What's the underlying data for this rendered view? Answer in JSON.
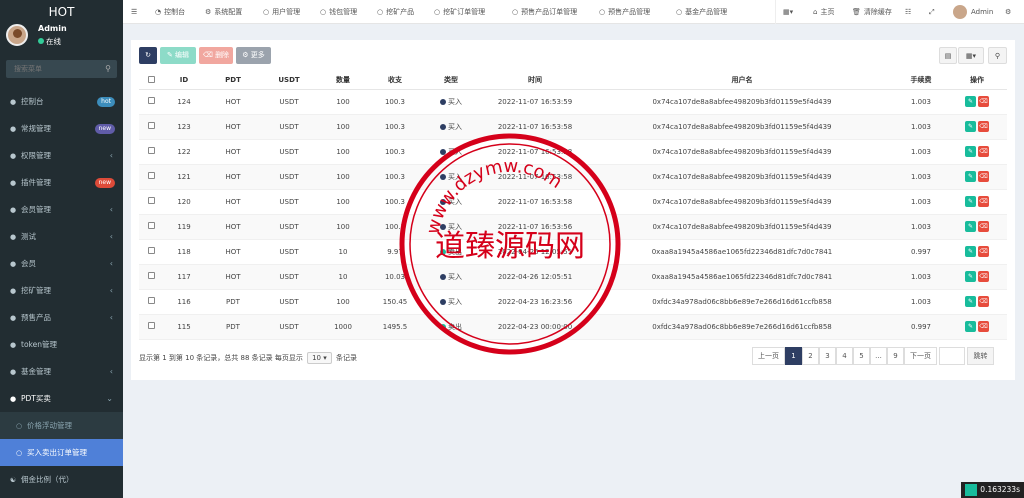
{
  "app": {
    "logo": "HOT"
  },
  "user": {
    "name": "Admin",
    "status": "在线"
  },
  "sidebar": {
    "search_placeholder": "搜索菜单",
    "items": [
      {
        "label": "控制台",
        "icon": "dashboard-icon",
        "badge": "hot",
        "badge_color": "#3c8dbc"
      },
      {
        "label": "常规管理",
        "icon": "gear-icon",
        "badge": "new",
        "badge_color": "#605ca8"
      },
      {
        "label": "权限管理",
        "icon": "users-icon",
        "chevron": "‹"
      },
      {
        "label": "插件管理",
        "icon": "rocket-icon",
        "badge": "new",
        "badge_color": "#dd4b39"
      },
      {
        "label": "会员管理",
        "icon": "user-icon",
        "chevron": "‹"
      },
      {
        "label": "测试",
        "icon": "flask-icon",
        "chevron": "‹"
      },
      {
        "label": "会员",
        "icon": "member-icon",
        "chevron": "‹"
      },
      {
        "label": "挖矿管理",
        "icon": "pickaxe-icon",
        "chevron": "‹"
      },
      {
        "label": "预售产品",
        "icon": "cart-icon",
        "chevron": "‹"
      },
      {
        "label": "token管理",
        "icon": "token-icon"
      },
      {
        "label": "基金管理",
        "icon": "fund-icon",
        "chevron": "‹"
      },
      {
        "label": "PDT买卖",
        "icon": "exchange-icon",
        "chevron": "⌄"
      }
    ],
    "sub_items": [
      {
        "label": "价格浮动管理"
      },
      {
        "label": "买入卖出订单管理"
      }
    ],
    "last_item": {
      "label": "佣金比例（代）",
      "icon": "percent-icon"
    }
  },
  "topbar": {
    "nav": [
      {
        "label": "控制台",
        "icon": "dashboard-icon"
      },
      {
        "label": "系统配置",
        "icon": "gear-icon"
      },
      {
        "label": "用户管理",
        "icon": "circle-icon"
      },
      {
        "label": "钱包管理",
        "icon": "circle-icon"
      },
      {
        "label": "挖矿产品",
        "icon": "circle-icon"
      },
      {
        "label": "挖矿订单管理",
        "icon": "circle-icon"
      },
      {
        "label": "预售产品订单管理",
        "icon": "circle-icon"
      },
      {
        "label": "预售产品管理",
        "icon": "circle-icon"
      },
      {
        "label": "基金产品管理",
        "icon": "circle-icon"
      }
    ],
    "home": "主页",
    "clear_cache": "清除缓存",
    "admin": "Admin"
  },
  "toolbar": {
    "edit": "编辑",
    "delete": "删除",
    "more": "更多"
  },
  "table": {
    "headers": [
      "ID",
      "PDT",
      "USDT",
      "数量",
      "收支",
      "类型",
      "时间",
      "用户名",
      "手续费",
      "操作"
    ],
    "rows": [
      [
        "124",
        "HOT",
        "USDT",
        "100",
        "100.3",
        "买入",
        "2022-11-07 16:53:59",
        "0x74ca107de8a8abfee498209b3fd01159e5f4d439",
        "1.003"
      ],
      [
        "123",
        "HOT",
        "USDT",
        "100",
        "100.3",
        "买入",
        "2022-11-07 16:53:58",
        "0x74ca107de8a8abfee498209b3fd01159e5f4d439",
        "1.003"
      ],
      [
        "122",
        "HOT",
        "USDT",
        "100",
        "100.3",
        "买入",
        "2022-11-07 16:53:58",
        "0x74ca107de8a8abfee498209b3fd01159e5f4d439",
        "1.003"
      ],
      [
        "121",
        "HOT",
        "USDT",
        "100",
        "100.3",
        "买入",
        "2022-11-07 16:53:58",
        "0x74ca107de8a8abfee498209b3fd01159e5f4d439",
        "1.003"
      ],
      [
        "120",
        "HOT",
        "USDT",
        "100",
        "100.3",
        "买入",
        "2022-11-07 16:53:58",
        "0x74ca107de8a8abfee498209b3fd01159e5f4d439",
        "1.003"
      ],
      [
        "119",
        "HOT",
        "USDT",
        "100",
        "100.3",
        "买入",
        "2022-11-07 16:53:56",
        "0x74ca107de8a8abfee498209b3fd01159e5f4d439",
        "1.003"
      ],
      [
        "118",
        "HOT",
        "USDT",
        "10",
        "9.97",
        "卖出",
        "2022-04-26 12:05:51",
        "0xaa8a1945a4586ae1065fd22346d81dfc7d0c7841",
        "0.997"
      ],
      [
        "117",
        "HOT",
        "USDT",
        "10",
        "10.03",
        "买入",
        "2022-04-26 12:05:51",
        "0xaa8a1945a4586ae1065fd22346d81dfc7d0c7841",
        "1.003"
      ],
      [
        "116",
        "PDT",
        "USDT",
        "100",
        "150.45",
        "买入",
        "2022-04-23 16:23:56",
        "0xfdc34a978ad06c8bb6e89e7e266d16d61ccfb858",
        "1.003"
      ],
      [
        "115",
        "PDT",
        "USDT",
        "1000",
        "1495.5",
        "卖出",
        "2022-04-23 00:00:00",
        "0xfdc34a978ad06c8bb6e89e7e266d16d61ccfb858",
        "0.997"
      ]
    ]
  },
  "pagination": {
    "info_prefix": "显示第 1 到第 10 条记录，总共 88 条记录 每页显示",
    "page_size": "10",
    "info_suffix": "条记录",
    "prev": "上一页",
    "pages": [
      "1",
      "2",
      "3",
      "4",
      "5",
      "...",
      "9"
    ],
    "next": "下一页",
    "jump": "跳转"
  },
  "watermark": {
    "center": "道臻源码网",
    "ring_text": "www.dzymw.com"
  },
  "timer": "0.163233s"
}
